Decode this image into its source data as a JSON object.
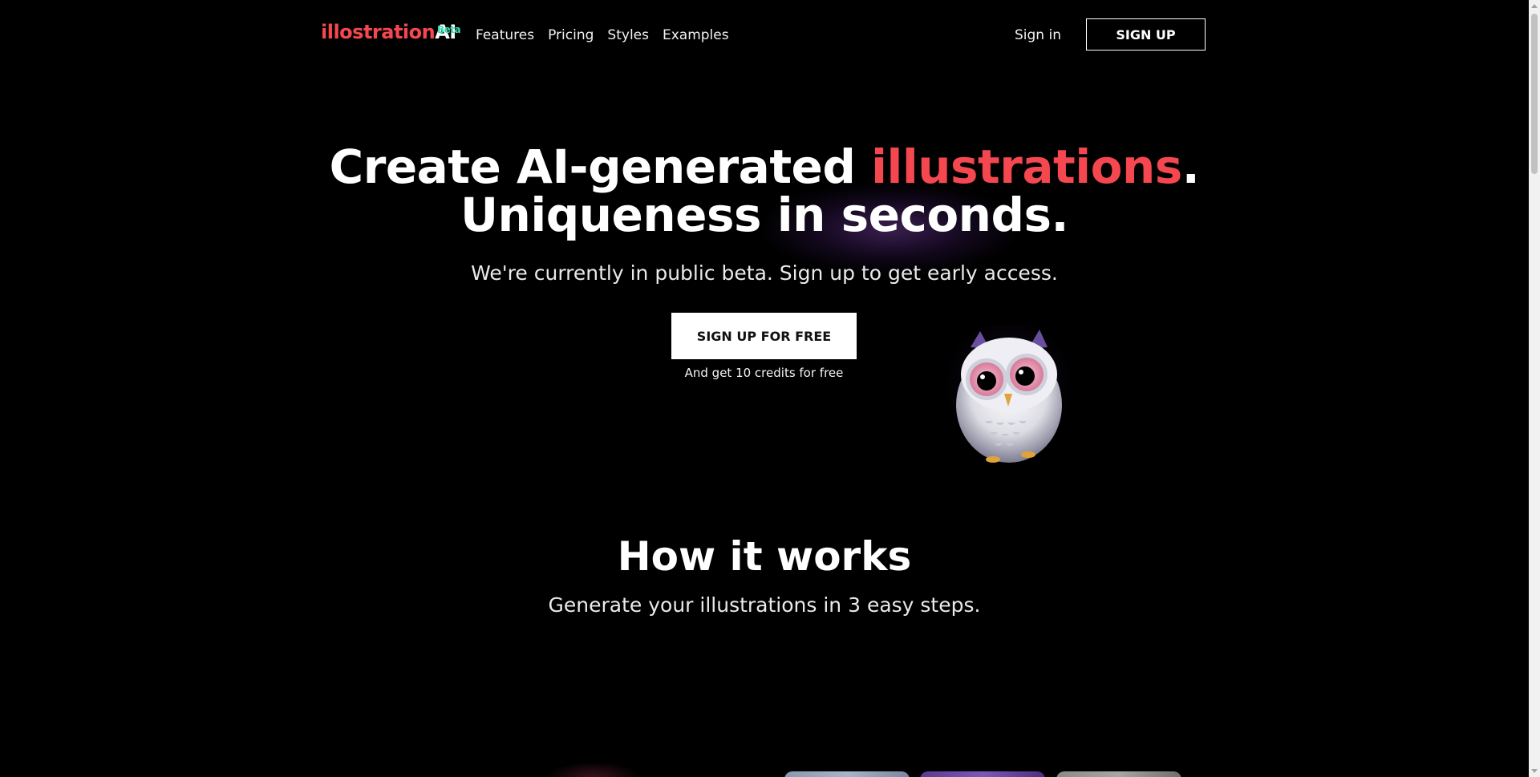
{
  "nav": {
    "logo_part1": "illostration",
    "logo_part2": "AI",
    "logo_badge": "Beta",
    "links": [
      {
        "label": "Features"
      },
      {
        "label": "Pricing"
      },
      {
        "label": "Styles"
      },
      {
        "label": "Examples"
      }
    ],
    "signin_label": "Sign in",
    "signup_label": "SIGN UP"
  },
  "hero": {
    "title_line1_pre": "Create AI-generated ",
    "title_line1_accent": "illustrations",
    "title_line1_post": ".",
    "title_line2": "Uniqueness in seconds.",
    "subtitle": "We're currently in public beta. Sign up to get early access.",
    "cta_label": "SIGN UP FOR FREE",
    "cta_note": "And get 10 credits for free"
  },
  "how": {
    "title": "How it works",
    "subtitle": "Generate your illustrations in 3 easy steps."
  },
  "colors": {
    "accent": "#f5474f",
    "beta": "#3ee0b0",
    "background": "#000000",
    "text": "#ffffff"
  },
  "icons": {
    "mascot": "owl-mascot"
  }
}
